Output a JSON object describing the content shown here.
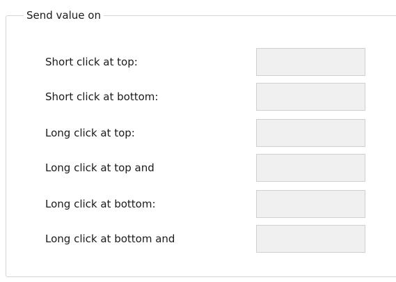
{
  "group": {
    "title": "Send value on"
  },
  "rows": [
    {
      "label": "Short click at top:",
      "value": ""
    },
    {
      "label": "Short click at bottom:",
      "value": ""
    },
    {
      "label": "Long click at top:",
      "value": ""
    },
    {
      "label": "Long click at top and",
      "value": ""
    },
    {
      "label": "Long click at bottom:",
      "value": ""
    },
    {
      "label": "Long click at bottom and",
      "value": ""
    }
  ]
}
